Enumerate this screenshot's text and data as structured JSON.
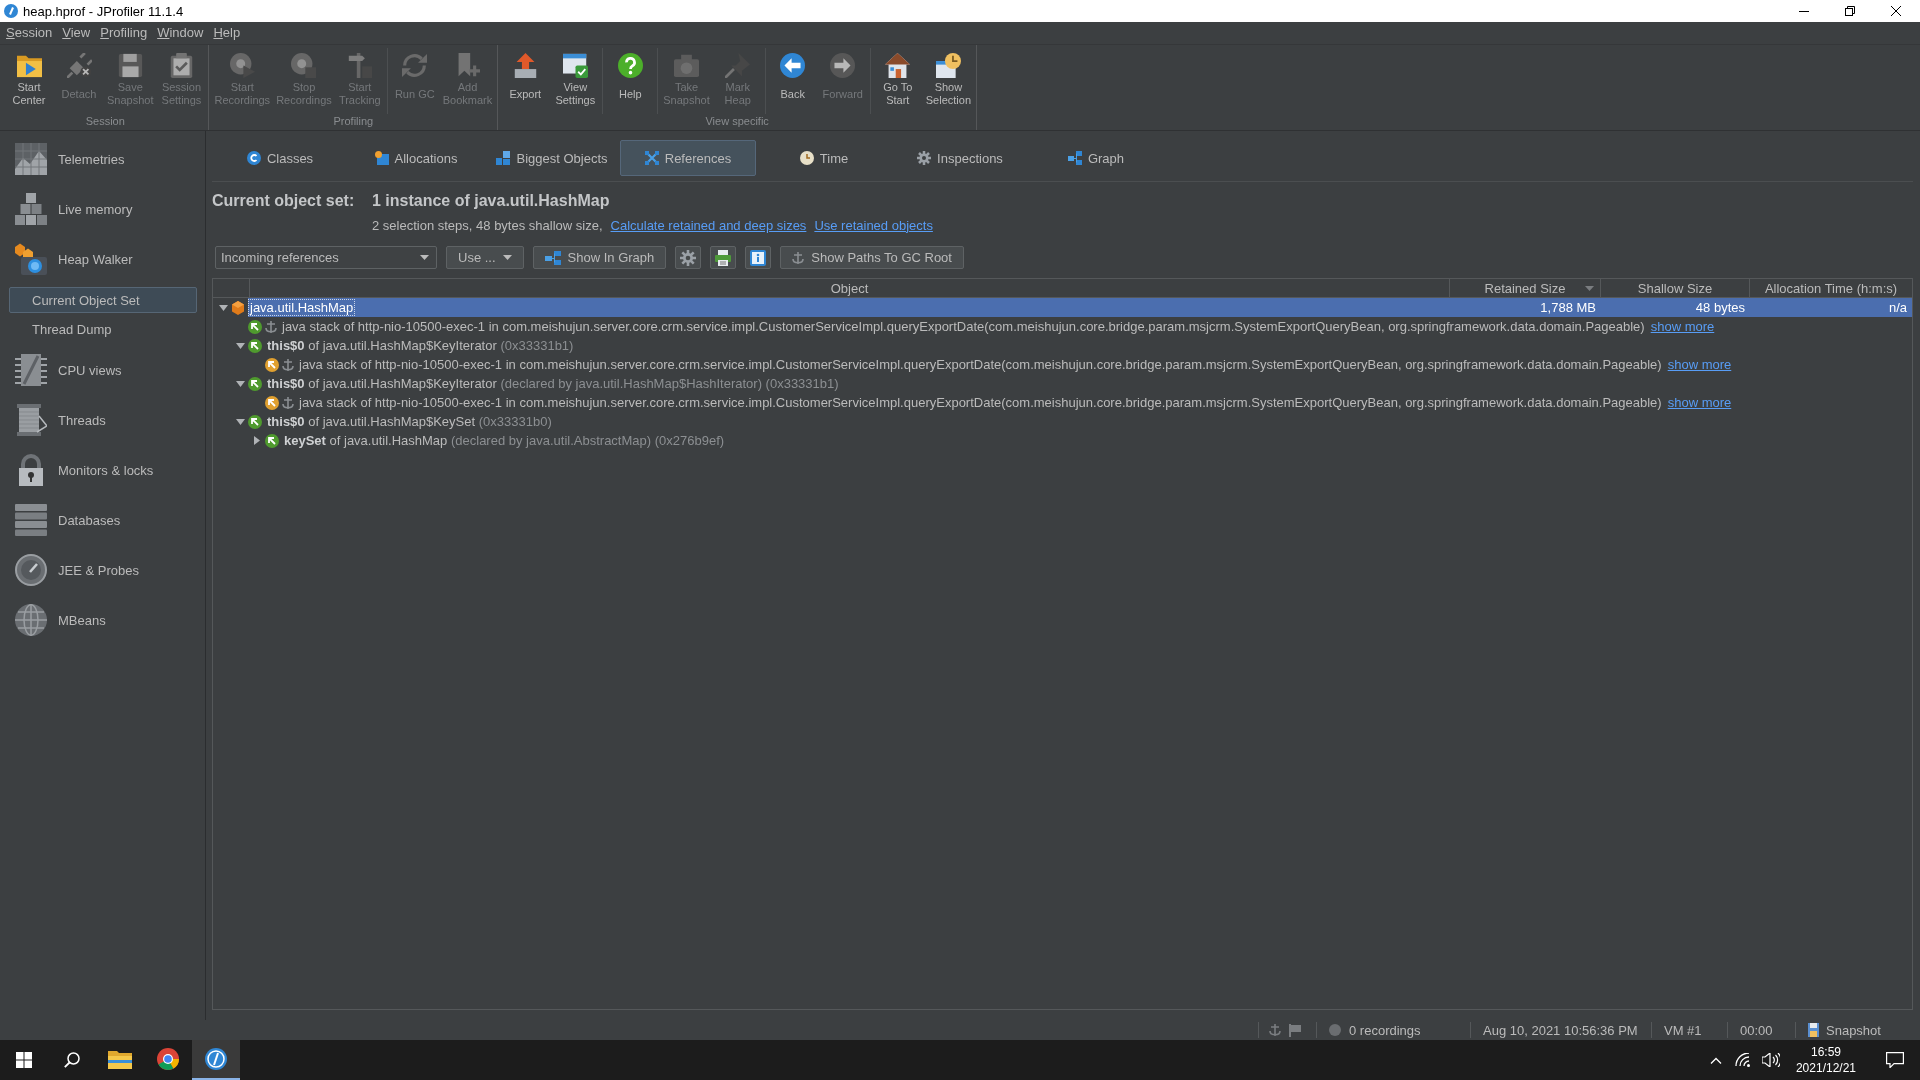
{
  "window": {
    "title": "heap.hprof - JProfiler 11.1.4"
  },
  "menu": [
    "Session",
    "View",
    "Profiling",
    "Window",
    "Help"
  ],
  "toolbar": {
    "groups": [
      {
        "label": "Session",
        "sections": [
          {
            "buttons": [
              {
                "label": "Start Center",
                "disabled": false
              },
              {
                "label": "Detach",
                "disabled": true
              },
              {
                "label": "Save Snapshot",
                "disabled": true
              },
              {
                "label": "Session Settings",
                "disabled": true
              }
            ]
          }
        ]
      },
      {
        "label": "Profiling",
        "sections": [
          {
            "buttons": [
              {
                "label": "Start Recordings",
                "disabled": true
              },
              {
                "label": "Stop Recordings",
                "disabled": true
              },
              {
                "label": "Start Tracking",
                "disabled": true
              }
            ]
          },
          {
            "buttons": [
              {
                "label": "Run GC",
                "disabled": true
              },
              {
                "label": "Add Bookmark",
                "disabled": true
              }
            ]
          }
        ]
      },
      {
        "label": "View specific",
        "sections": [
          {
            "buttons": [
              {
                "label": "Export",
                "disabled": false
              },
              {
                "label": "View Settings",
                "disabled": false
              }
            ]
          },
          {
            "buttons": [
              {
                "label": "Help",
                "disabled": false
              }
            ]
          },
          {
            "buttons": [
              {
                "label": "Take Snapshot",
                "disabled": true
              },
              {
                "label": "Mark Heap",
                "disabled": true
              }
            ]
          },
          {
            "buttons": [
              {
                "label": "Back",
                "disabled": false
              },
              {
                "label": "Forward",
                "disabled": true
              }
            ]
          },
          {
            "buttons": [
              {
                "label": "Go To Start",
                "disabled": false
              },
              {
                "label": "Show Selection",
                "disabled": false
              }
            ]
          }
        ]
      }
    ]
  },
  "sidebar": {
    "items": [
      {
        "label": "Telemetries",
        "selected": false
      },
      {
        "label": "Live memory",
        "selected": false
      },
      {
        "label": "Heap Walker",
        "selected": false,
        "children": [
          {
            "label": "Current Object Set",
            "selected": true
          },
          {
            "label": "Thread Dump",
            "selected": false
          }
        ]
      },
      {
        "label": "CPU views",
        "selected": false
      },
      {
        "label": "Threads",
        "selected": false
      },
      {
        "label": "Monitors & locks",
        "selected": false
      },
      {
        "label": "Databases",
        "selected": false
      },
      {
        "label": "JEE & Probes",
        "selected": false
      },
      {
        "label": "MBeans",
        "selected": false
      }
    ]
  },
  "tabs": [
    {
      "label": "Classes",
      "selected": false
    },
    {
      "label": "Allocations",
      "selected": false
    },
    {
      "label": "Biggest Objects",
      "selected": false
    },
    {
      "label": "References",
      "selected": true
    },
    {
      "label": "Time",
      "selected": false
    },
    {
      "label": "Inspections",
      "selected": false
    },
    {
      "label": "Graph",
      "selected": false
    }
  ],
  "object_set": {
    "title": "Current object set:",
    "value": "1 instance of java.util.HashMap",
    "info": "2 selection steps, 48 bytes shallow size,",
    "links": [
      "Calculate retained and deep sizes",
      "Use retained objects"
    ]
  },
  "controls": {
    "view_selector": {
      "value": "Incoming references"
    },
    "use_button": "Use ...",
    "graph_button": "Show In Graph",
    "paths_button": "Show Paths To GC Root"
  },
  "table": {
    "columns": [
      {
        "label": "Object",
        "sorted": false
      },
      {
        "label": "Retained Size",
        "sorted": true
      },
      {
        "label": "Shallow Size",
        "sorted": false
      },
      {
        "label": "Allocation Time (h:m:s)",
        "sorted": false
      }
    ],
    "rows": [
      {
        "kind": "class",
        "label": "java.util.HashMap",
        "selected": true,
        "expanded": true,
        "retained_size": "1,788 MB",
        "shallow_size": "48 bytes",
        "allocation_time": "n/a",
        "children": [
          {
            "kind": "gc_root",
            "color": "#4f9a2e",
            "label": "java stack of http-nio-10500-exec-1 in com.meishujun.server.core.crm.service.impl.CustomerServiceImpl.queryExportDate(com.meishujun.core.bridge.param.msjcrm.SystemExportQueryBean, org.springframework.data.domain.Pageable)",
            "link": "show more",
            "selected": false
          },
          {
            "kind": "field",
            "color": "#4f9a2e",
            "label": "**this$0** of java.util.HashMap$KeyIterator",
            "detail": "(0x33331b1)",
            "selected": false,
            "expanded": true,
            "children": [
              {
                "kind": "gc_root",
                "color": "#e0a030",
                "label": "java stack of http-nio-10500-exec-1 in com.meishujun.server.core.crm.service.impl.CustomerServiceImpl.queryExportDate(com.meishujun.core.bridge.param.msjcrm.SystemExportQueryBean, org.springframework.data.domain.Pageable)",
                "link": "show more",
                "selected": false
              }
            ]
          },
          {
            "kind": "field",
            "color": "#4f9a2e",
            "label": "**this$0** of java.util.HashMap$KeyIterator",
            "detail": "(declared by java.util.HashMap$HashIterator) (0x33331b1)",
            "selected": false,
            "expanded": true,
            "children": [
              {
                "kind": "gc_root",
                "color": "#e0a030",
                "label": "java stack of http-nio-10500-exec-1 in com.meishujun.server.core.crm.service.impl.CustomerServiceImpl.queryExportDate(com.meishujun.core.bridge.param.msjcrm.SystemExportQueryBean, org.springframework.data.domain.Pageable)",
                "link": "show more",
                "selected": false
              }
            ]
          },
          {
            "kind": "field",
            "color": "#4f9a2e",
            "label": "**this$0** of java.util.HashMap$KeySet",
            "detail": "(0x33331b0)",
            "selected": false,
            "expanded": true,
            "children": [
              {
                "kind": "field",
                "color": "#4f9a2e",
                "label": "**keySet** of java.util.HashMap",
                "detail": "(declared by java.util.AbstractMap) (0x276b9ef)",
                "selected": false,
                "expanded": false
              }
            ]
          }
        ]
      }
    ]
  },
  "status_bar": {
    "recordings": "0 recordings",
    "timestamp": "Aug 10, 2021 10:56:36 PM",
    "vm": "VM #1",
    "elapsed": "00:00",
    "mode": "Snapshot"
  },
  "taskbar": {
    "apps": [
      {
        "active": false
      },
      {
        "active": false
      },
      {
        "active": true
      }
    ],
    "time": "16:59",
    "date": "2021/12/21"
  }
}
